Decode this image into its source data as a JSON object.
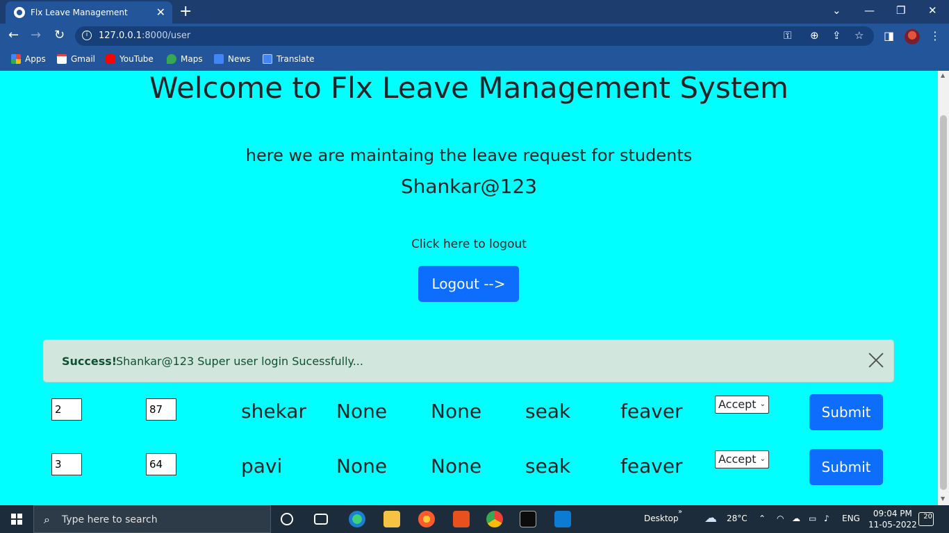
{
  "browser": {
    "tab_title": "Flx Leave Management",
    "url_host": "127.0.0.1",
    "url_path": ":8000/user",
    "bookmarks": [
      {
        "label": "Apps",
        "icon": "apps-grid-icon",
        "color": "#f4b400"
      },
      {
        "label": "Gmail",
        "icon": "gmail-icon",
        "color": "#ea4335"
      },
      {
        "label": "YouTube",
        "icon": "youtube-icon",
        "color": "#ff0000"
      },
      {
        "label": "Maps",
        "icon": "maps-icon",
        "color": "#34a853"
      },
      {
        "label": "News",
        "icon": "news-icon",
        "color": "#4285f4"
      },
      {
        "label": "Translate",
        "icon": "translate-icon",
        "color": "#4285f4"
      }
    ]
  },
  "page": {
    "heading": "Welcome to Flx Leave Management System",
    "lead": "here we are maintaing the leave request for students",
    "username": "Shankar@123",
    "logout_text": "Click here to logout",
    "logout_button": "Logout -->",
    "alert": {
      "strong": "Success!",
      "message": "Shankar@123 Super user login Sucessfully..."
    },
    "rows": [
      {
        "id": "2",
        "num": "87",
        "name": "shekar",
        "col3": "None",
        "col4": "None",
        "type": "seak",
        "reason": "feaver",
        "status": "Accept",
        "submit": "Submit"
      },
      {
        "id": "3",
        "num": "64",
        "name": "pavi",
        "col3": "None",
        "col4": "None",
        "type": "seak",
        "reason": "feaver",
        "status": "Accept",
        "submit": "Submit"
      }
    ]
  },
  "taskbar": {
    "search_placeholder": "Type here to search",
    "desktop_label": "Desktop",
    "temperature": "28°C",
    "language": "ENG",
    "time": "09:04 PM",
    "date": "11-05-2022",
    "notifications": "20"
  },
  "colors": {
    "page_bg": "#00ffff",
    "primary": "#0d6efd",
    "alert_bg": "#d1e7dd",
    "chrome": "#23559a"
  }
}
